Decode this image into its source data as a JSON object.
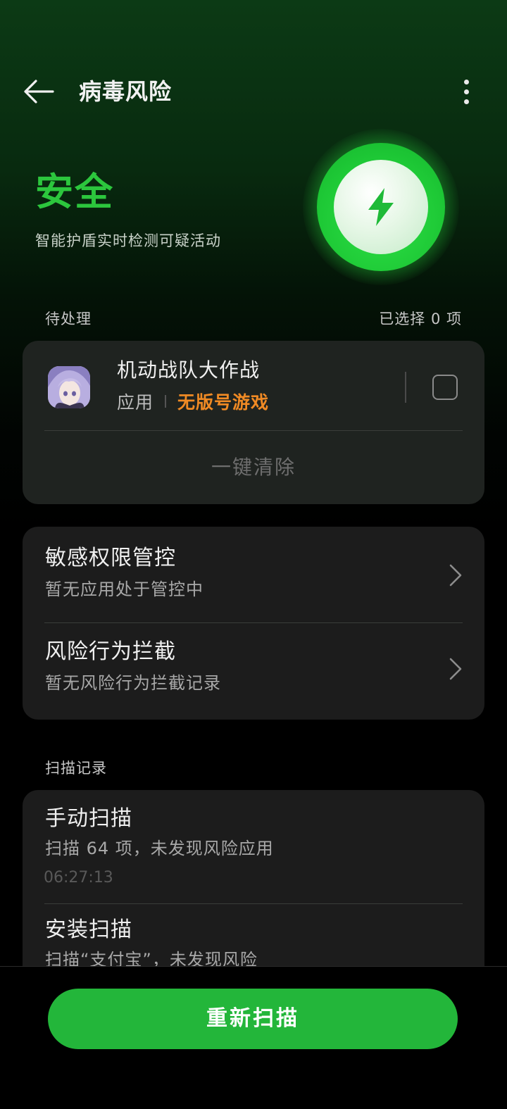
{
  "header": {
    "title": "病毒风险",
    "back_icon": "arrow-left-icon",
    "more_icon": "more-vertical-icon"
  },
  "status": {
    "title": "安全",
    "description": "智能护盾实时检测可疑活动",
    "icon": "lightning-shield-icon",
    "color": "#2cc63d"
  },
  "pending": {
    "label": "待处理",
    "selected_count": "已选择 0 项",
    "items": [
      {
        "name": "机动战队大作战",
        "type": "应用",
        "tag": "无版号游戏",
        "checked": false
      }
    ],
    "clear_label": "一键清除"
  },
  "controls": [
    {
      "title": "敏感权限管控",
      "subtitle": "暂无应用处于管控中"
    },
    {
      "title": "风险行为拦截",
      "subtitle": "暂无风险行为拦截记录"
    }
  ],
  "scan_records": {
    "label": "扫描记录",
    "items": [
      {
        "title": "手动扫描",
        "subtitle": "扫描 64 项，未发现风险应用",
        "time": "06:27:13"
      },
      {
        "title": "安装扫描",
        "subtitle": "扫描“支付宝”，未发现风险"
      }
    ]
  },
  "actions": {
    "rescan_label": "重新扫描",
    "accent_color": "#23b63a"
  }
}
